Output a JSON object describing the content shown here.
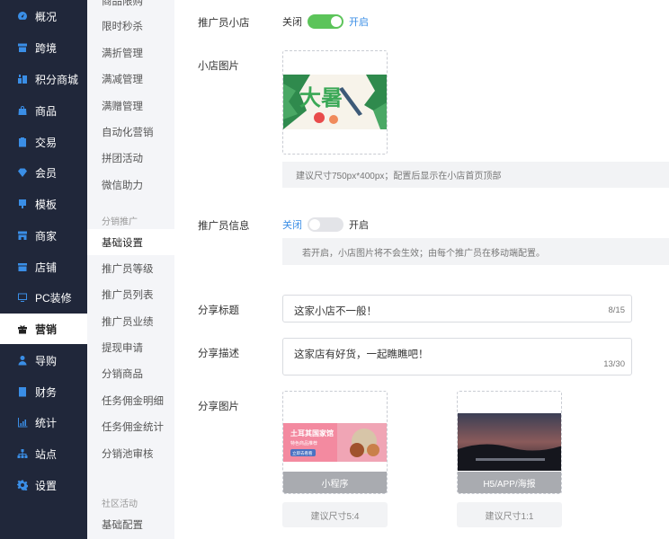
{
  "nav": {
    "items": [
      {
        "label": "概况",
        "icon": "gauge-icon"
      },
      {
        "label": "跨境",
        "icon": "box-icon"
      },
      {
        "label": "积分商城",
        "icon": "mall-icon"
      },
      {
        "label": "商品",
        "icon": "bag-icon"
      },
      {
        "label": "交易",
        "icon": "clipboard-icon"
      },
      {
        "label": "会员",
        "icon": "diamond-icon"
      },
      {
        "label": "模板",
        "icon": "template-icon"
      },
      {
        "label": "商家",
        "icon": "store-icon"
      },
      {
        "label": "店铺",
        "icon": "shop-icon"
      },
      {
        "label": "PC装修",
        "icon": "monitor-icon"
      },
      {
        "label": "营销",
        "icon": "gift-icon"
      },
      {
        "label": "导购",
        "icon": "person-icon"
      },
      {
        "label": "财务",
        "icon": "wallet-icon"
      },
      {
        "label": "统计",
        "icon": "bar-chart-icon"
      },
      {
        "label": "站点",
        "icon": "sitemap-icon"
      },
      {
        "label": "设置",
        "icon": "gear-icon"
      }
    ],
    "active": "营销"
  },
  "submenu": {
    "items_top": [
      "商品限购",
      "限时秒杀",
      "满折管理",
      "满减管理",
      "满赠管理",
      "自动化营销",
      "拼团活动",
      "微信助力"
    ],
    "group1": "分销推广",
    "items_group1": [
      "基础设置",
      "推广员等级",
      "推广员列表",
      "推广员业绩",
      "提现申请",
      "分销商品",
      "任务佣金明细",
      "任务佣金统计",
      "分销池审核"
    ],
    "group2": "社区活动",
    "items_group2": [
      "基础配置"
    ],
    "active": "基础设置"
  },
  "form": {
    "shop_label": "推广员小店",
    "shop_switch": {
      "off": "关闭",
      "on": "开启",
      "state": "on"
    },
    "shop_image_label": "小店图片",
    "shop_image_hint": "建议尺寸750px*400px；配置后显示在小店首页顶部",
    "banner_text": "大暑",
    "info_label": "推广员信息",
    "info_switch": {
      "off": "关闭",
      "on": "开启",
      "state": "off"
    },
    "info_hint": "若开启，小店图片将不会生效；由每个推广员在移动端配置。",
    "share_title_label": "分享标题",
    "share_title_value": "这家小店不一般！",
    "share_title_count": "8/15",
    "share_desc_label": "分享描述",
    "share_desc_value": "这家店有好货，一起瞧瞧吧！",
    "share_desc_count": "13/30",
    "share_image_label": "分享图片",
    "share_images": [
      {
        "caption": "小程序",
        "size_hint": "建议尺寸5:4",
        "poster_title": "土耳其国家馆",
        "poster_sub": "特色商品推荐",
        "poster_btn": "立即去看看"
      },
      {
        "caption": "H5/APP/海报",
        "size_hint": "建议尺寸1:1"
      }
    ]
  },
  "colors": {
    "nav_bg": "#20273a",
    "accent": "#3a8ee6",
    "switch_on": "#5cc45a"
  }
}
